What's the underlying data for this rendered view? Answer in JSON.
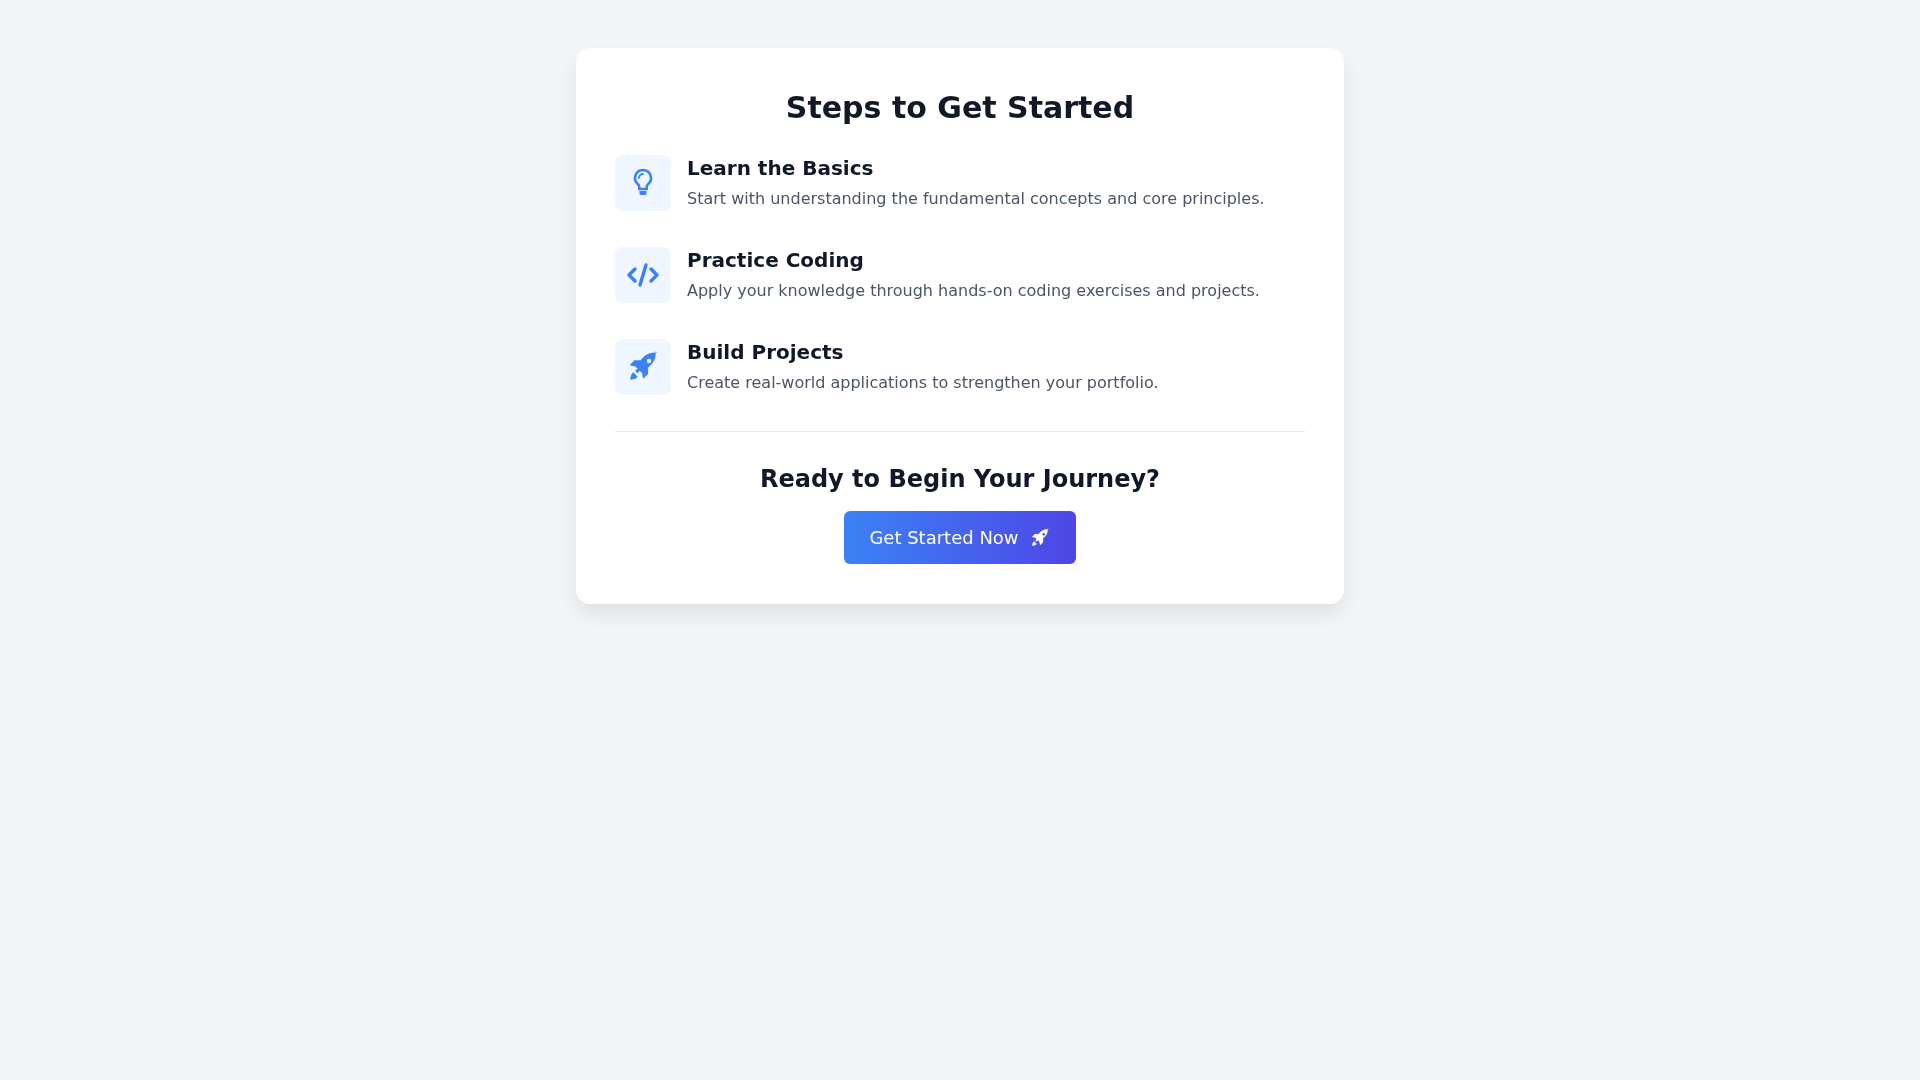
{
  "title": "Steps to Get Started",
  "steps": [
    {
      "title": "Learn the Basics",
      "description": "Start with understanding the fundamental concepts and core principles."
    },
    {
      "title": "Practice Coding",
      "description": "Apply your knowledge through hands-on coding exercises and projects."
    },
    {
      "title": "Build Projects",
      "description": "Create real-world applications to strengthen your portfolio."
    }
  ],
  "cta": {
    "heading": "Ready to Begin Your Journey?",
    "button": "Get Started Now"
  }
}
